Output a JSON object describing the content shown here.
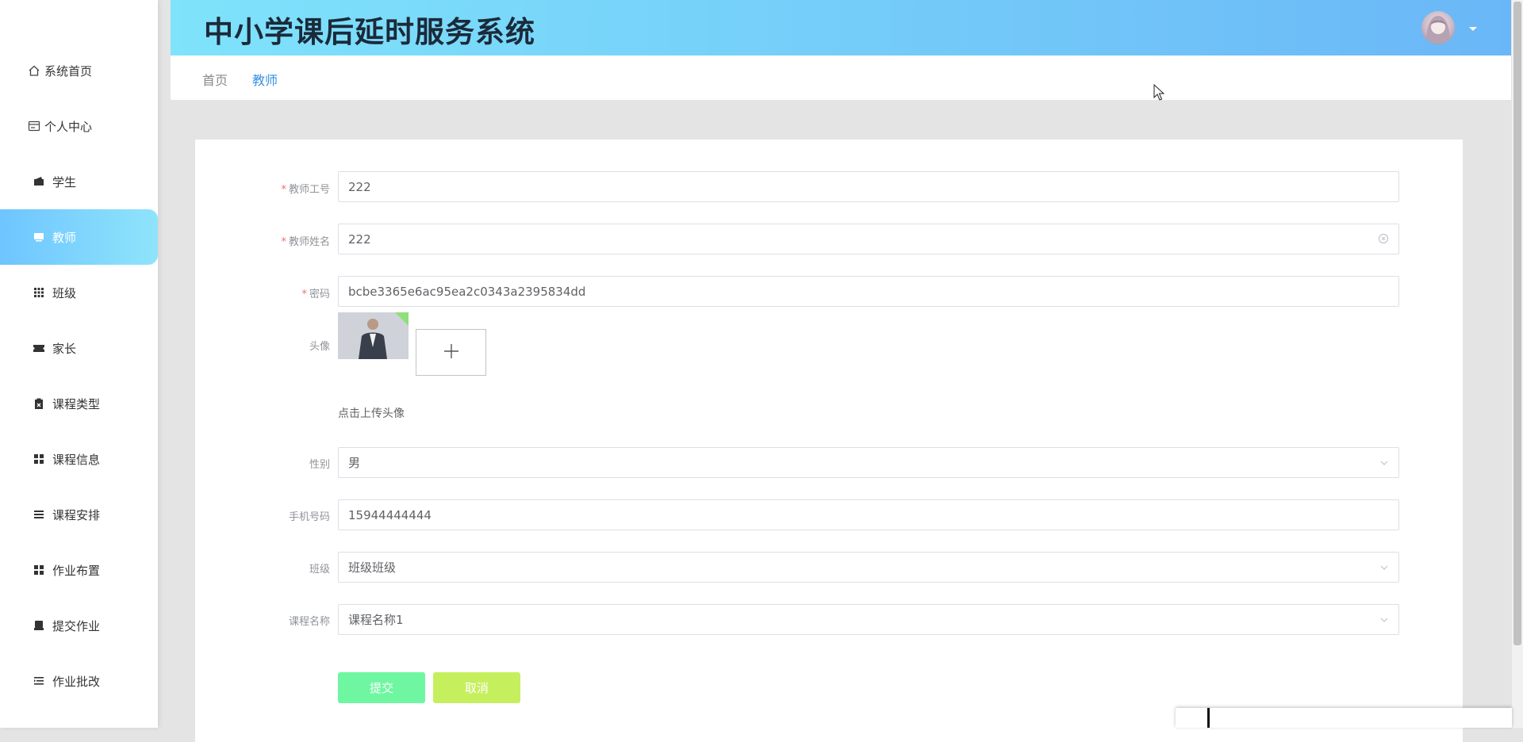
{
  "app": {
    "title": "中小学课后延时服务系统"
  },
  "sidebar": {
    "items": [
      {
        "label": "系统首页",
        "icon": "home-icon"
      },
      {
        "label": "个人中心",
        "icon": "user-card-icon"
      },
      {
        "label": "学生",
        "icon": "wallet-icon"
      },
      {
        "label": "教师",
        "icon": "monitor-icon",
        "active": true
      },
      {
        "label": "班级",
        "icon": "grid-icon"
      },
      {
        "label": "家长",
        "icon": "ticket-icon"
      },
      {
        "label": "课程类型",
        "icon": "clipboard-icon"
      },
      {
        "label": "课程信息",
        "icon": "apps-icon"
      },
      {
        "label": "课程安排",
        "icon": "list-icon"
      },
      {
        "label": "作业布置",
        "icon": "apps-icon"
      },
      {
        "label": "提交作业",
        "icon": "printer-icon"
      },
      {
        "label": "作业批改",
        "icon": "indent-list-icon"
      }
    ]
  },
  "breadcrumb": {
    "home": "首页",
    "current": "教师"
  },
  "form": {
    "teacher_id": {
      "label": "教师工号",
      "value": "222",
      "required": true
    },
    "teacher_name": {
      "label": "教师姓名",
      "value": "222",
      "required": true
    },
    "password": {
      "label": "密码",
      "value": "bcbe3365e6ac95ea2c0343a2395834dd",
      "required": true
    },
    "avatar": {
      "label": "头像",
      "tip": "点击上传头像"
    },
    "gender": {
      "label": "性别",
      "value": "男"
    },
    "phone": {
      "label": "手机号码",
      "value": "15944444444"
    },
    "class": {
      "label": "班级",
      "value": "班级班级"
    },
    "course_name": {
      "label": "课程名称",
      "value": "课程名称1"
    },
    "submit_label": "提交",
    "cancel_label": "取消"
  },
  "colors": {
    "accent": "#409eff",
    "required": "#f56c6c",
    "submit": "#6ef7a0",
    "cancel": "#c6ef5e"
  }
}
